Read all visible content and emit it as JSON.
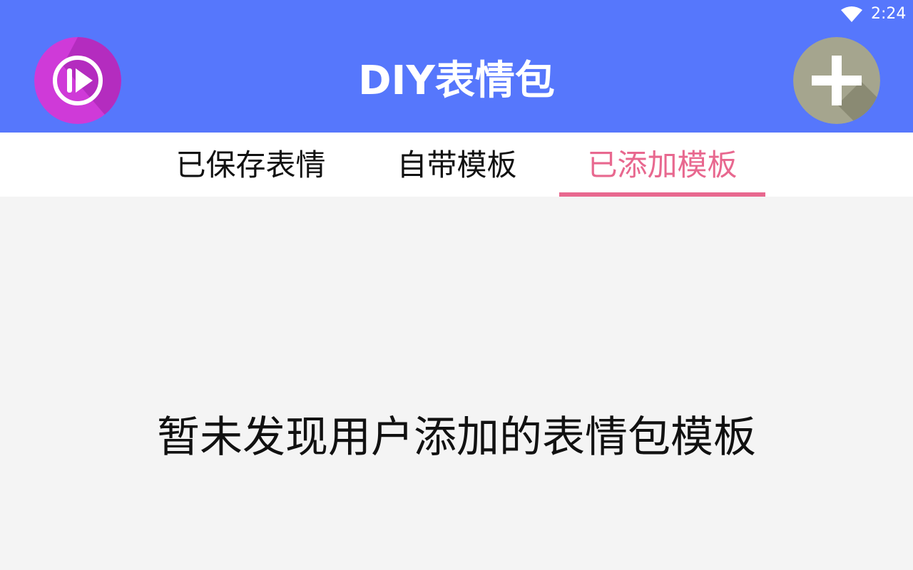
{
  "status_bar": {
    "time": "2:24",
    "wifi_icon": "wifi-icon"
  },
  "app_bar": {
    "title": "DIY表情包",
    "color": "#5677fc",
    "left_button_icon": "play-circle-icon",
    "right_button_icon": "plus-icon"
  },
  "tabs": [
    {
      "label": "已保存表情",
      "selected": false
    },
    {
      "label": "自带模板",
      "selected": false
    },
    {
      "label": "已添加模板",
      "selected": true
    }
  ],
  "accent_color": "#e8688f",
  "content": {
    "empty_message": "暂未发现用户添加的表情包模板"
  }
}
